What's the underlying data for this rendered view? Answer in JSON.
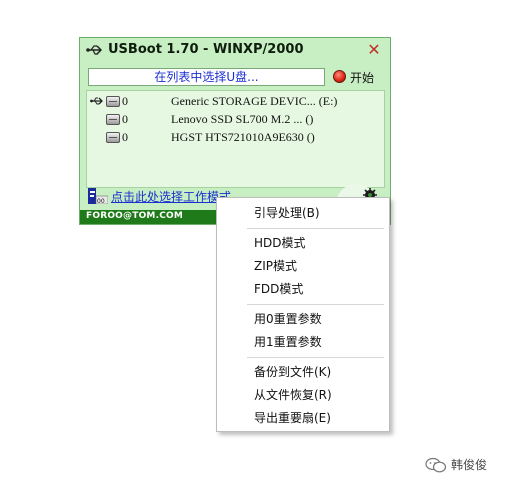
{
  "window": {
    "title": "USBoot 1.70 - WINXP/2000",
    "close_glyph": "✕"
  },
  "toolbar": {
    "hint": "在列表中选择U盘...",
    "start_label": "开始",
    "start_icon": "red-circle-icon"
  },
  "devices": [
    {
      "num": "0",
      "name": "Generic STORAGE DEVIC... (E:)",
      "usb": true
    },
    {
      "num": "0",
      "name": "Lenovo SSD SL700 M.2 ... ()",
      "usb": false
    },
    {
      "num": "0",
      "name": "HGST HTS721010A9E630 ()",
      "usb": false
    }
  ],
  "mode_link": "点击此处选择工作模式",
  "footer": "FOROO@TOM.COM",
  "menu": {
    "items": [
      "引导处理(B)",
      "HDD模式",
      "ZIP模式",
      "FDD模式",
      "用0重置参数",
      "用1重置参数",
      "备份到文件(K)",
      "从文件恢复(R)",
      "导出重要扇(E)"
    ]
  },
  "watermark": "韩俊俊",
  "colors": {
    "window_bg": "#c7efc3",
    "footer_bg": "#1f7a1a",
    "link": "#1b2fd0",
    "close": "#c0302a"
  }
}
